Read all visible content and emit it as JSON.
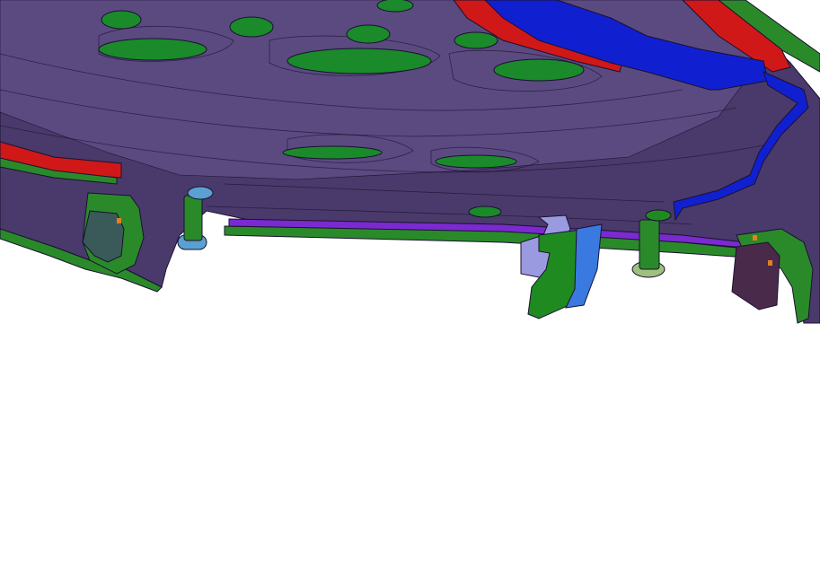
{
  "viewport": {
    "background": "#ffffff",
    "description_free": true
  },
  "model": {
    "panel_fill": "#4a3a6b",
    "panel_fill_light": "#5a4a80",
    "edge_line": "#1a1030",
    "cutout_fill": "#1a8a2a",
    "seal_red": "#d01818",
    "seal_blue": "#1020d0",
    "flange_green": "#2a8a2a",
    "bottom_strip_purple": "#7a2ad0",
    "latch_green": "#1f8a20",
    "latch_blue": "#3a7ae0",
    "bracket_lilac": "#9a9ae0",
    "bumper_purple": "#4a2a4a",
    "hinge_teal": "#3a5a5a",
    "stop_blue": "#5aa0d0",
    "stop_green": "#a0c080",
    "accent_orange": "#e08020"
  },
  "parts": [
    {
      "icon": "hood-inner-panel"
    },
    {
      "icon": "seal-strip-red"
    },
    {
      "icon": "seal-strip-blue"
    },
    {
      "icon": "hood-latch"
    },
    {
      "icon": "hood-stop-left"
    },
    {
      "icon": "hood-stop-right"
    },
    {
      "icon": "hinge-bracket-left"
    },
    {
      "icon": "bumper-bracket-right"
    }
  ]
}
